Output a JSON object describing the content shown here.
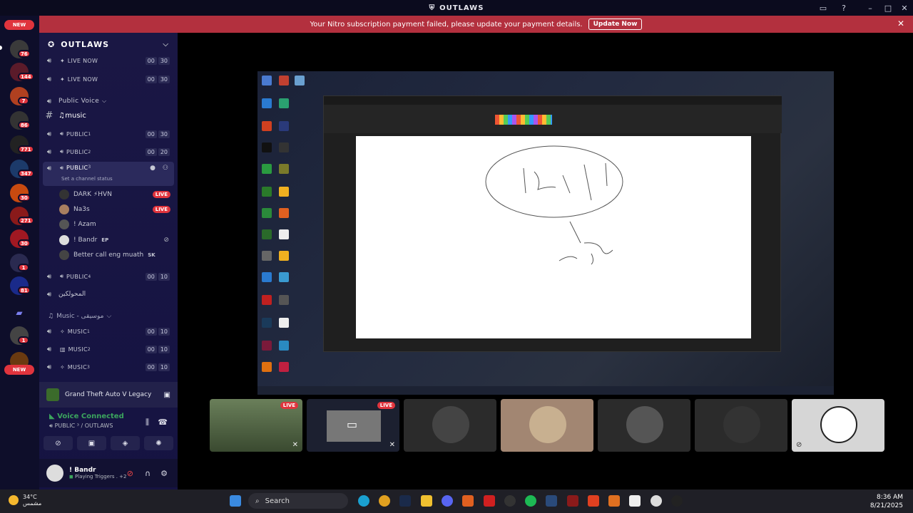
{
  "titlebar": {
    "title": "OUTLAWS"
  },
  "banner": {
    "message": "Your Nitro subscription payment failed, please update your payment details.",
    "button": "Update Now"
  },
  "guilds": {
    "new_label": "NEW",
    "badges": [
      "76",
      "144",
      "7",
      "86",
      "771",
      "347",
      "30",
      "271",
      "30",
      "1",
      "81",
      "1"
    ]
  },
  "server": {
    "name": "OUTLAWS"
  },
  "channels": {
    "live1": "LIVE NOW",
    "live2": "LIVE NOW",
    "cat_public": "Public Voice",
    "music_text": "music",
    "public1": "PUBLIC",
    "public2": "PUBLIC",
    "public3": "PUBLIC",
    "public4": "PUBLIC",
    "status_hint": "Set a channel status",
    "ar_channel": "المحولكين",
    "cat_music": "Music - موسيقى",
    "music1": "MUSIC",
    "music2": "MUSIC",
    "music3": "MUSIC",
    "n00": "00",
    "n30": "30",
    "n20": "20",
    "n10": "10",
    "sup1": "1",
    "sup2": "2",
    "sup3": "3",
    "sup4": "4"
  },
  "members": [
    {
      "name": "DARK ⚡HVN",
      "live": "LIVE"
    },
    {
      "name": "Na3s",
      "live": "LIVE"
    },
    {
      "name": "! Azam"
    },
    {
      "name": "! Bandr",
      "tag": "EP"
    },
    {
      "name": "Better call eng muath",
      "tag": "SK"
    }
  ],
  "activity": {
    "game": "Grand Theft Auto V Legacy"
  },
  "voice": {
    "status": "Voice Connected",
    "channel": "PUBLIC ³ / OUTLAWS"
  },
  "user": {
    "name": "! Bandr",
    "status": "Playing Triggers . +2"
  },
  "tiles": {
    "live": "LIVE"
  },
  "taskbar": {
    "temp": "34°C",
    "weather": "مشمس",
    "search": "Search",
    "time": "8:36 AM",
    "date": "8/21/2025"
  },
  "colors": {
    "accent": "#5865f2",
    "live_red": "#e0343d",
    "banner_red": "#b3303e",
    "voice_green": "#3ba55d"
  }
}
